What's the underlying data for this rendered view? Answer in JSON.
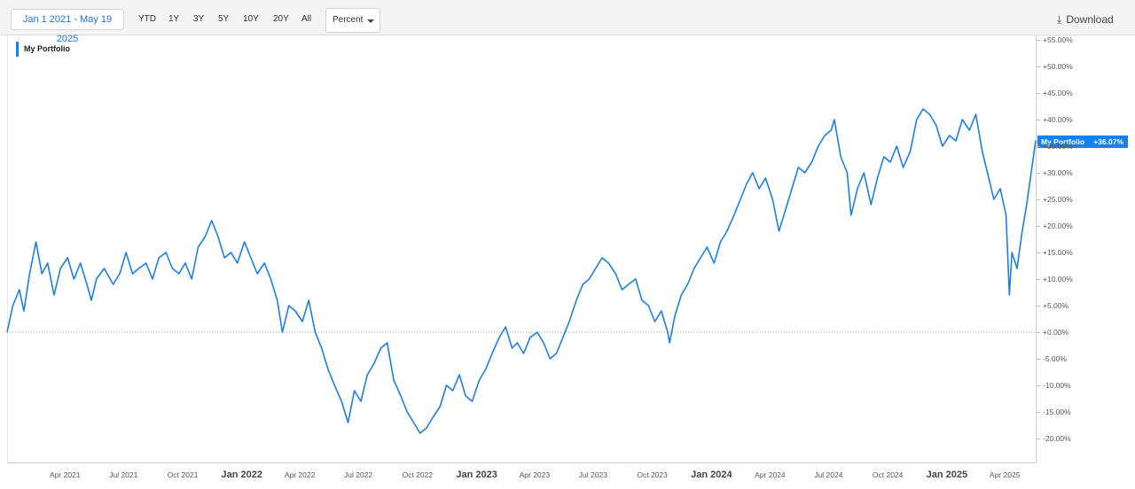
{
  "toolbar": {
    "date_range": "Jan 1 2021 - May 19 2025",
    "periods": [
      "YTD",
      "1Y",
      "3Y",
      "5Y",
      "10Y",
      "20Y",
      "All"
    ],
    "mode": "Percent",
    "download_label": "Download",
    "download_icon": "download-icon"
  },
  "legend": {
    "label": "My Portfolio",
    "color": "#1a7fe8"
  },
  "last_value_badge": {
    "label": "My Portfolio",
    "value": "+36.07%"
  },
  "chart_data": {
    "type": "line",
    "title": "",
    "xlabel": "",
    "ylabel": "",
    "ylim": [
      -20,
      55
    ],
    "x_range": [
      "2021-01-01",
      "2025-05-19"
    ],
    "y_ticks": [
      "+55.00%",
      "+50.00%",
      "+45.00%",
      "+40.00%",
      "+35.00%",
      "+30.00%",
      "+25.00%",
      "+20.00%",
      "+15.00%",
      "+10.00%",
      "+5.00%",
      "+0.00%",
      "-5.00%",
      "-10.00%",
      "-15.00%",
      "-20.00%"
    ],
    "x_ticks": [
      {
        "label": "Apr 2021",
        "date": "2021-04-01",
        "major": false
      },
      {
        "label": "Jul 2021",
        "date": "2021-07-01",
        "major": false
      },
      {
        "label": "Oct 2021",
        "date": "2021-10-01",
        "major": false
      },
      {
        "label": "Jan 2022",
        "date": "2022-01-01",
        "major": true
      },
      {
        "label": "Apr 2022",
        "date": "2022-04-01",
        "major": false
      },
      {
        "label": "Jul 2022",
        "date": "2022-07-01",
        "major": false
      },
      {
        "label": "Oct 2022",
        "date": "2022-10-01",
        "major": false
      },
      {
        "label": "Jan 2023",
        "date": "2023-01-01",
        "major": true
      },
      {
        "label": "Apr 2023",
        "date": "2023-04-01",
        "major": false
      },
      {
        "label": "Jul 2023",
        "date": "2023-07-01",
        "major": false
      },
      {
        "label": "Oct 2023",
        "date": "2023-10-01",
        "major": false
      },
      {
        "label": "Jan 2024",
        "date": "2024-01-01",
        "major": true
      },
      {
        "label": "Apr 2024",
        "date": "2024-04-01",
        "major": false
      },
      {
        "label": "Jul 2024",
        "date": "2024-07-01",
        "major": false
      },
      {
        "label": "Oct 2024",
        "date": "2024-10-01",
        "major": false
      },
      {
        "label": "Jan 2025",
        "date": "2025-01-01",
        "major": true
      },
      {
        "label": "Apr 2025",
        "date": "2025-04-01",
        "major": false
      }
    ],
    "zero_line": true,
    "grid": false,
    "legend_position": "top-left",
    "series": [
      {
        "name": "My Portfolio",
        "color": "#1a7fe8",
        "points": [
          [
            "2021-01-01",
            0
          ],
          [
            "2021-01-10",
            5
          ],
          [
            "2021-01-20",
            8
          ],
          [
            "2021-01-27",
            4
          ],
          [
            "2021-02-05",
            11
          ],
          [
            "2021-02-15",
            17
          ],
          [
            "2021-02-24",
            11
          ],
          [
            "2021-03-05",
            13
          ],
          [
            "2021-03-15",
            7
          ],
          [
            "2021-03-25",
            12
          ],
          [
            "2021-04-05",
            14
          ],
          [
            "2021-04-15",
            10
          ],
          [
            "2021-04-25",
            13
          ],
          [
            "2021-05-05",
            9
          ],
          [
            "2021-05-12",
            6
          ],
          [
            "2021-05-20",
            10
          ],
          [
            "2021-06-01",
            12
          ],
          [
            "2021-06-15",
            9
          ],
          [
            "2021-06-25",
            11
          ],
          [
            "2021-07-05",
            15
          ],
          [
            "2021-07-15",
            11
          ],
          [
            "2021-07-25",
            12
          ],
          [
            "2021-08-05",
            13
          ],
          [
            "2021-08-15",
            10
          ],
          [
            "2021-08-25",
            14
          ],
          [
            "2021-09-05",
            15
          ],
          [
            "2021-09-15",
            12
          ],
          [
            "2021-09-25",
            11
          ],
          [
            "2021-10-05",
            13
          ],
          [
            "2021-10-15",
            10
          ],
          [
            "2021-10-25",
            16
          ],
          [
            "2021-11-05",
            18
          ],
          [
            "2021-11-15",
            21
          ],
          [
            "2021-11-25",
            18
          ],
          [
            "2021-12-05",
            14
          ],
          [
            "2021-12-15",
            15
          ],
          [
            "2021-12-25",
            13
          ],
          [
            "2022-01-05",
            17
          ],
          [
            "2022-01-15",
            14
          ],
          [
            "2022-01-25",
            11
          ],
          [
            "2022-02-05",
            13
          ],
          [
            "2022-02-15",
            10
          ],
          [
            "2022-02-25",
            6
          ],
          [
            "2022-03-05",
            0
          ],
          [
            "2022-03-15",
            5
          ],
          [
            "2022-03-25",
            4
          ],
          [
            "2022-04-05",
            2
          ],
          [
            "2022-04-15",
            6
          ],
          [
            "2022-04-25",
            0
          ],
          [
            "2022-05-05",
            -3
          ],
          [
            "2022-05-15",
            -7
          ],
          [
            "2022-05-25",
            -10
          ],
          [
            "2022-06-05",
            -13
          ],
          [
            "2022-06-15",
            -17
          ],
          [
            "2022-06-25",
            -11
          ],
          [
            "2022-07-05",
            -13
          ],
          [
            "2022-07-15",
            -8
          ],
          [
            "2022-07-25",
            -6
          ],
          [
            "2022-08-05",
            -3
          ],
          [
            "2022-08-15",
            -2
          ],
          [
            "2022-08-25",
            -9
          ],
          [
            "2022-09-05",
            -12
          ],
          [
            "2022-09-15",
            -15
          ],
          [
            "2022-09-25",
            -17
          ],
          [
            "2022-10-05",
            -19
          ],
          [
            "2022-10-15",
            -18
          ],
          [
            "2022-10-25",
            -16
          ],
          [
            "2022-11-05",
            -14
          ],
          [
            "2022-11-15",
            -10
          ],
          [
            "2022-11-25",
            -11
          ],
          [
            "2022-12-05",
            -8
          ],
          [
            "2022-12-15",
            -12
          ],
          [
            "2022-12-25",
            -13
          ],
          [
            "2023-01-05",
            -9
          ],
          [
            "2023-01-15",
            -7
          ],
          [
            "2023-01-25",
            -4
          ],
          [
            "2023-02-05",
            -1
          ],
          [
            "2023-02-15",
            1
          ],
          [
            "2023-02-25",
            -3
          ],
          [
            "2023-03-05",
            -2
          ],
          [
            "2023-03-15",
            -4
          ],
          [
            "2023-03-25",
            -1
          ],
          [
            "2023-04-05",
            0
          ],
          [
            "2023-04-15",
            -2
          ],
          [
            "2023-04-25",
            -5
          ],
          [
            "2023-05-05",
            -4
          ],
          [
            "2023-05-15",
            -1
          ],
          [
            "2023-05-25",
            2
          ],
          [
            "2023-06-05",
            6
          ],
          [
            "2023-06-15",
            9
          ],
          [
            "2023-06-25",
            10
          ],
          [
            "2023-07-05",
            12
          ],
          [
            "2023-07-15",
            14
          ],
          [
            "2023-07-25",
            13
          ],
          [
            "2023-08-05",
            11
          ],
          [
            "2023-08-15",
            8
          ],
          [
            "2023-08-25",
            9
          ],
          [
            "2023-09-05",
            10
          ],
          [
            "2023-09-15",
            6
          ],
          [
            "2023-09-25",
            5
          ],
          [
            "2023-10-05",
            2
          ],
          [
            "2023-10-15",
            4
          ],
          [
            "2023-10-25",
            0
          ],
          [
            "2023-10-28",
            -2
          ],
          [
            "2023-11-05",
            3
          ],
          [
            "2023-11-15",
            7
          ],
          [
            "2023-11-25",
            9
          ],
          [
            "2023-12-05",
            12
          ],
          [
            "2023-12-15",
            14
          ],
          [
            "2023-12-25",
            16
          ],
          [
            "2024-01-05",
            13
          ],
          [
            "2024-01-15",
            17
          ],
          [
            "2024-01-25",
            19
          ],
          [
            "2024-02-05",
            22
          ],
          [
            "2024-02-15",
            25
          ],
          [
            "2024-02-25",
            28
          ],
          [
            "2024-03-05",
            30
          ],
          [
            "2024-03-15",
            27
          ],
          [
            "2024-03-25",
            29
          ],
          [
            "2024-04-05",
            25
          ],
          [
            "2024-04-15",
            19
          ],
          [
            "2024-04-25",
            23
          ],
          [
            "2024-05-05",
            27
          ],
          [
            "2024-05-15",
            31
          ],
          [
            "2024-05-25",
            30
          ],
          [
            "2024-06-05",
            32
          ],
          [
            "2024-06-15",
            35
          ],
          [
            "2024-06-25",
            37
          ],
          [
            "2024-07-05",
            38
          ],
          [
            "2024-07-10",
            40
          ],
          [
            "2024-07-20",
            33
          ],
          [
            "2024-07-30",
            30
          ],
          [
            "2024-08-05",
            22
          ],
          [
            "2024-08-15",
            27
          ],
          [
            "2024-08-25",
            30
          ],
          [
            "2024-09-05",
            24
          ],
          [
            "2024-09-15",
            29
          ],
          [
            "2024-09-25",
            33
          ],
          [
            "2024-10-05",
            32
          ],
          [
            "2024-10-15",
            35
          ],
          [
            "2024-10-25",
            31
          ],
          [
            "2024-11-05",
            34
          ],
          [
            "2024-11-15",
            40
          ],
          [
            "2024-11-25",
            42
          ],
          [
            "2024-12-05",
            41
          ],
          [
            "2024-12-15",
            39
          ],
          [
            "2024-12-25",
            35
          ],
          [
            "2025-01-05",
            37
          ],
          [
            "2025-01-15",
            36
          ],
          [
            "2025-01-25",
            40
          ],
          [
            "2025-02-05",
            38
          ],
          [
            "2025-02-15",
            41
          ],
          [
            "2025-02-25",
            34
          ],
          [
            "2025-03-05",
            30
          ],
          [
            "2025-03-15",
            25
          ],
          [
            "2025-03-25",
            27
          ],
          [
            "2025-04-03",
            22
          ],
          [
            "2025-04-08",
            7
          ],
          [
            "2025-04-12",
            15
          ],
          [
            "2025-04-20",
            12
          ],
          [
            "2025-04-28",
            19
          ],
          [
            "2025-05-05",
            24
          ],
          [
            "2025-05-12",
            30
          ],
          [
            "2025-05-19",
            36.07
          ]
        ]
      }
    ]
  }
}
